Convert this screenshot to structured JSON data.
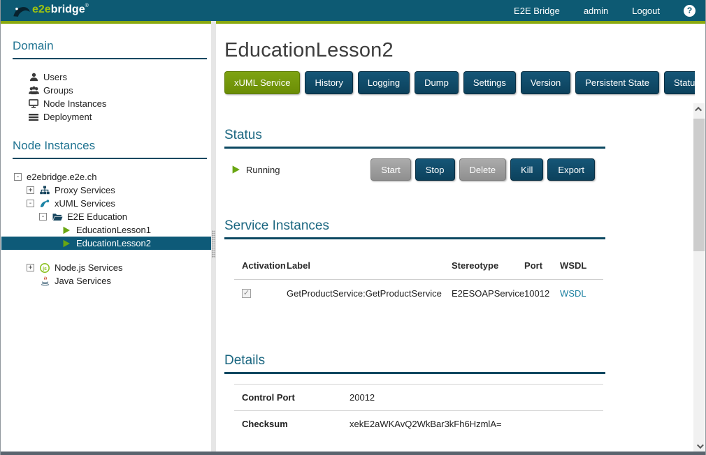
{
  "header": {
    "logo_e2e": "e2e",
    "logo_bridge": "bridge",
    "logo_reg": "®",
    "product": "E2E Bridge",
    "user": "admin",
    "logout": "Logout",
    "help": "?"
  },
  "sidebar": {
    "domain": {
      "title": "Domain",
      "items": [
        {
          "label": "Users",
          "icon": "user-icon"
        },
        {
          "label": "Groups",
          "icon": "users-icon"
        },
        {
          "label": "Node Instances",
          "icon": "monitor-icon"
        },
        {
          "label": "Deployment",
          "icon": "deployment-icon"
        }
      ]
    },
    "node_instances": {
      "title": "Node Instances",
      "tree": [
        {
          "label": "e2ebridge.e2e.ch",
          "level": 0,
          "expander": "-",
          "icon": null,
          "selected": false
        },
        {
          "label": "Proxy Services",
          "level": 1,
          "expander": "+",
          "icon": "sitemap-icon",
          "selected": false
        },
        {
          "label": "xUML Services",
          "level": 1,
          "expander": "-",
          "icon": "xuml-icon",
          "selected": false
        },
        {
          "label": "E2E Education",
          "level": 2,
          "expander": "-",
          "icon": "folder-open-icon",
          "selected": false
        },
        {
          "label": "EducationLesson1",
          "level": 3,
          "expander": null,
          "icon": "play-icon",
          "selected": false
        },
        {
          "label": "EducationLesson2",
          "level": 3,
          "expander": null,
          "icon": "play-icon",
          "selected": true
        },
        {
          "label": "Node.js Services",
          "level": 1,
          "expander": "+",
          "icon": "nodejs-icon",
          "selected": false
        },
        {
          "label": "Java Services",
          "level": 1,
          "expander": null,
          "icon": "java-icon",
          "selected": false
        }
      ]
    }
  },
  "main": {
    "title": "EducationLesson2",
    "tabs": [
      {
        "label": "xUML Service",
        "active": true
      },
      {
        "label": "History",
        "active": false
      },
      {
        "label": "Logging",
        "active": false
      },
      {
        "label": "Dump",
        "active": false
      },
      {
        "label": "Settings",
        "active": false
      },
      {
        "label": "Version",
        "active": false
      },
      {
        "label": "Persistent State",
        "active": false
      },
      {
        "label": "Status",
        "active": false
      }
    ],
    "status": {
      "title": "Status",
      "state": "Running",
      "buttons": [
        {
          "label": "Start",
          "disabled": true
        },
        {
          "label": "Stop",
          "disabled": false
        },
        {
          "label": "Delete",
          "disabled": true
        },
        {
          "label": "Kill",
          "disabled": false
        },
        {
          "label": "Export",
          "disabled": false
        }
      ]
    },
    "service_instances": {
      "title": "Service Instances",
      "columns": [
        "Activation",
        "Label",
        "Stereotype",
        "Port",
        "WSDL"
      ],
      "rows": [
        {
          "activation_checked": "✓",
          "label": "GetProductService:GetProductService",
          "stereotype": "E2ESOAPService",
          "port": "10012",
          "wsdl": "WSDL"
        }
      ]
    },
    "details": {
      "title": "Details",
      "rows": [
        {
          "label": "Control Port",
          "value": "20012"
        },
        {
          "label": "Checksum",
          "value": "xekE2aWKAvQ2WkBar3kFh6HzmlA="
        }
      ]
    }
  },
  "colors": {
    "header_teal": "#0d5a73",
    "accent_green": "#8aa90f",
    "active_tab_green": "#6b8d05",
    "button_teal": "#0c415c",
    "selection_teal": "#0e5a78",
    "heading_teal": "#1a6680",
    "link_teal": "#1a7fa0"
  }
}
